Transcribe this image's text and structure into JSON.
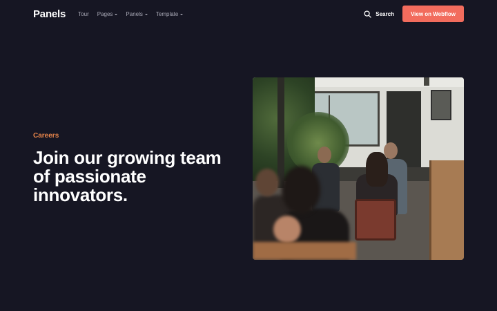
{
  "nav": {
    "brand": "Panels",
    "links": [
      {
        "label": "Tour",
        "dropdown": false
      },
      {
        "label": "Pages",
        "dropdown": true
      },
      {
        "label": "Panels",
        "dropdown": true
      },
      {
        "label": "Template",
        "dropdown": true
      }
    ],
    "search_label": "Search",
    "search_icon": "search-icon",
    "cta_label": "View on Webflow"
  },
  "hero": {
    "eyebrow": "Careers",
    "headline": "Join our growing team of passionate innovators."
  },
  "colors": {
    "background": "#161623",
    "accent": "#f26c5d",
    "eyebrow": "#e8854a",
    "nav_link": "#a9a9b6"
  }
}
